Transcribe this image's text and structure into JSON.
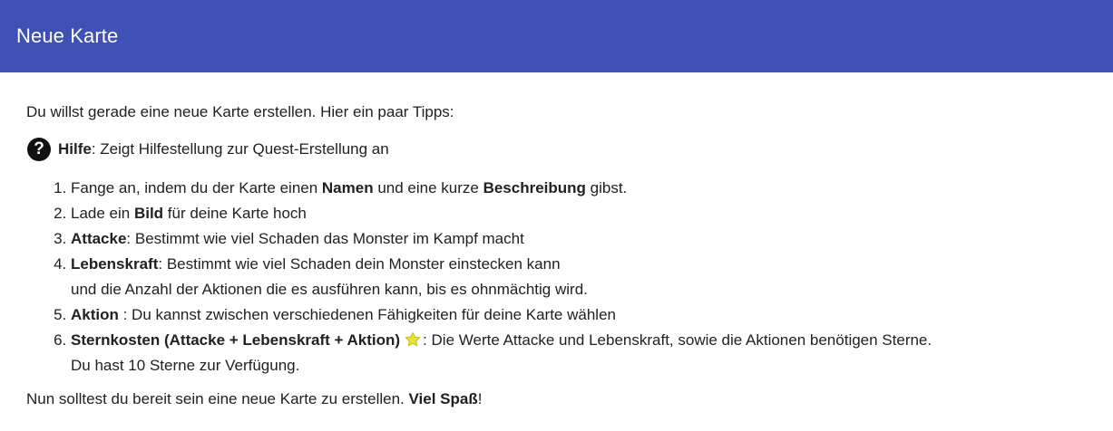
{
  "header": {
    "title": "Neue Karte"
  },
  "intro": "Du willst gerade eine neue Karte erstellen. Hier ein paar Tipps:",
  "help": {
    "icon": "question-circle-icon",
    "label": "Hilfe",
    "text": ": Zeigt Hilfestellung zur Quest-Erstellung an"
  },
  "tips": [
    {
      "t1": "Fange an, indem du der Karte einen ",
      "b1": "Namen",
      "t2": " und eine kurze ",
      "b2": "Beschreibung",
      "t3": " gibst."
    },
    {
      "t1": "Lade ein ",
      "b1": "Bild",
      "t2": " für deine Karte hoch"
    },
    {
      "b1": "Attacke",
      "t1": ": Bestimmt wie viel Schaden das Monster im Kampf macht"
    },
    {
      "b1": "Lebenskraft",
      "t1": ": Bestimmt wie viel Schaden dein Monster einstecken kann",
      "t2": "und die Anzahl der Aktionen die es ausführen kann, bis es ohnmächtig wird."
    },
    {
      "b1": "Aktion",
      "t1": " : Du kannst zwischen verschiedenen Fähigkeiten für deine Karte wählen"
    },
    {
      "b1": "Sternkosten (Attacke + Lebenskraft + Aktion)",
      "icon": "star-icon",
      "t1": ": Die Werte Attacke und Lebenskraft, sowie die Aktionen benötigen Sterne.",
      "t2": "Du hast 10 Sterne zur Verfügung."
    }
  ],
  "outro": {
    "text": "Nun solltest du bereit sein eine neue Karte zu erstellen. ",
    "bold": "Viel Spaß",
    "end": "!"
  },
  "colors": {
    "header_bg": "#3f51b5",
    "header_text": "#ffffff",
    "body_text": "#212121",
    "star": "#e6e23a"
  }
}
